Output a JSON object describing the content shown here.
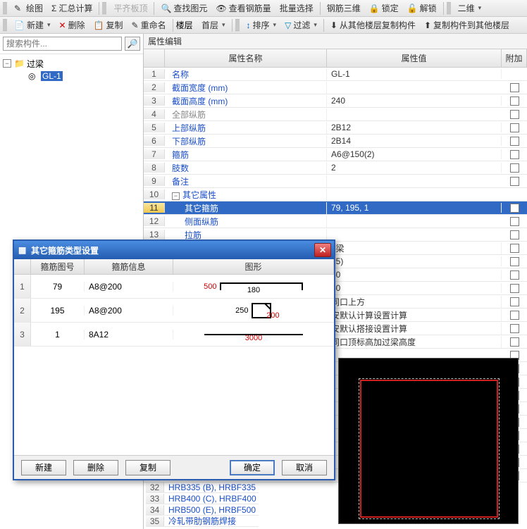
{
  "toolbar1": {
    "draw": "绘图",
    "sum": "汇总计算",
    "flatten": "平齐板顶",
    "find": "查找图元",
    "rebar": "查看钢筋量",
    "batch": "批量选择",
    "rebar3d": "钢筋三维",
    "lock": "锁定",
    "unlock": "解锁",
    "twoD": "二维"
  },
  "toolbar2": {
    "new": "新建",
    "delete": "删除",
    "copy": "复制",
    "rename": "重命名",
    "floorLbl": "楼层",
    "floorVal": "首层",
    "sort": "排序",
    "filter": "过滤",
    "copyFrom": "从其他楼层复制构件",
    "copyTo": "复制构件到其他楼层"
  },
  "search_placeholder": "搜索构件...",
  "tree": {
    "root": "过梁",
    "child": "GL-1"
  },
  "prop_title": "属性编辑",
  "prop_head": {
    "name": "属性名称",
    "val": "属性值",
    "add": "附加"
  },
  "rows": [
    {
      "n": "1",
      "name": "名称",
      "val": "GL-1",
      "link": true
    },
    {
      "n": "2",
      "name": "截面宽度 (mm)",
      "val": "",
      "link": true,
      "chk": true
    },
    {
      "n": "3",
      "name": "截面高度 (mm)",
      "val": "240",
      "link": true,
      "chk": true
    },
    {
      "n": "4",
      "name": "全部纵筋",
      "val": "",
      "gray": true,
      "chk": true
    },
    {
      "n": "5",
      "name": "上部纵筋",
      "val": "2B12",
      "link": true,
      "chk": true
    },
    {
      "n": "6",
      "name": "下部纵筋",
      "val": "2B14",
      "link": true,
      "chk": true
    },
    {
      "n": "7",
      "name": "箍筋",
      "val": "A6@150(2)",
      "link": true,
      "chk": true
    },
    {
      "n": "8",
      "name": "肢数",
      "val": "2",
      "link": true,
      "chk": true
    },
    {
      "n": "9",
      "name": "备注",
      "val": "",
      "link": true,
      "chk": true
    },
    {
      "n": "10",
      "name": "其它属性",
      "group": true
    },
    {
      "n": "11",
      "name": "其它箍筋",
      "val": "79, 195, 1",
      "indent": true,
      "sel": true,
      "chk": true
    },
    {
      "n": "12",
      "name": "侧面纵筋",
      "val": "",
      "indent": true,
      "link": true,
      "chk": true
    },
    {
      "n": "13",
      "name": "拉筋",
      "val": "",
      "indent": true,
      "link": true,
      "chk": true
    }
  ],
  "extra_rows": [
    {
      "val": "3梁",
      "chk": true
    },
    {
      "val": "25)",
      "chk": true
    },
    {
      "val": "50",
      "chk": true
    },
    {
      "val": "50",
      "chk": true
    },
    {
      "val": "同口上方",
      "chk": true
    },
    {
      "val": "安默认计算设置计算",
      "chk": true
    },
    {
      "val": "安默认搭接设置计算",
      "chk": true
    },
    {
      "val": "同口顶标高加过梁高度",
      "chk": true
    }
  ],
  "under": [
    {
      "n": "32",
      "name": "HRB335 (B), HRBF335"
    },
    {
      "n": "33",
      "name": "HRB400 (C), HRBF400"
    },
    {
      "n": "34",
      "name": "HRB500 (E), HRBF500"
    },
    {
      "n": "35",
      "name": "冷轧带肋钢筋焊接"
    }
  ],
  "dialog": {
    "title": "其它箍筋类型设置",
    "head": {
      "id": "箍筋图号",
      "info": "箍筋信息",
      "shape": "图形"
    },
    "rows": [
      {
        "n": "1",
        "id": "79",
        "info": "A8@200",
        "d1": "500",
        "d2": "180"
      },
      {
        "n": "2",
        "id": "195",
        "info": "A8@200",
        "d1": "250",
        "d2": "200"
      },
      {
        "n": "3",
        "id": "1",
        "info": "8A12",
        "d1": "",
        "d2": "3000"
      }
    ],
    "btn_new": "新建",
    "btn_del": "删除",
    "btn_copy": "复制",
    "btn_ok": "确定",
    "btn_cancel": "取消"
  }
}
